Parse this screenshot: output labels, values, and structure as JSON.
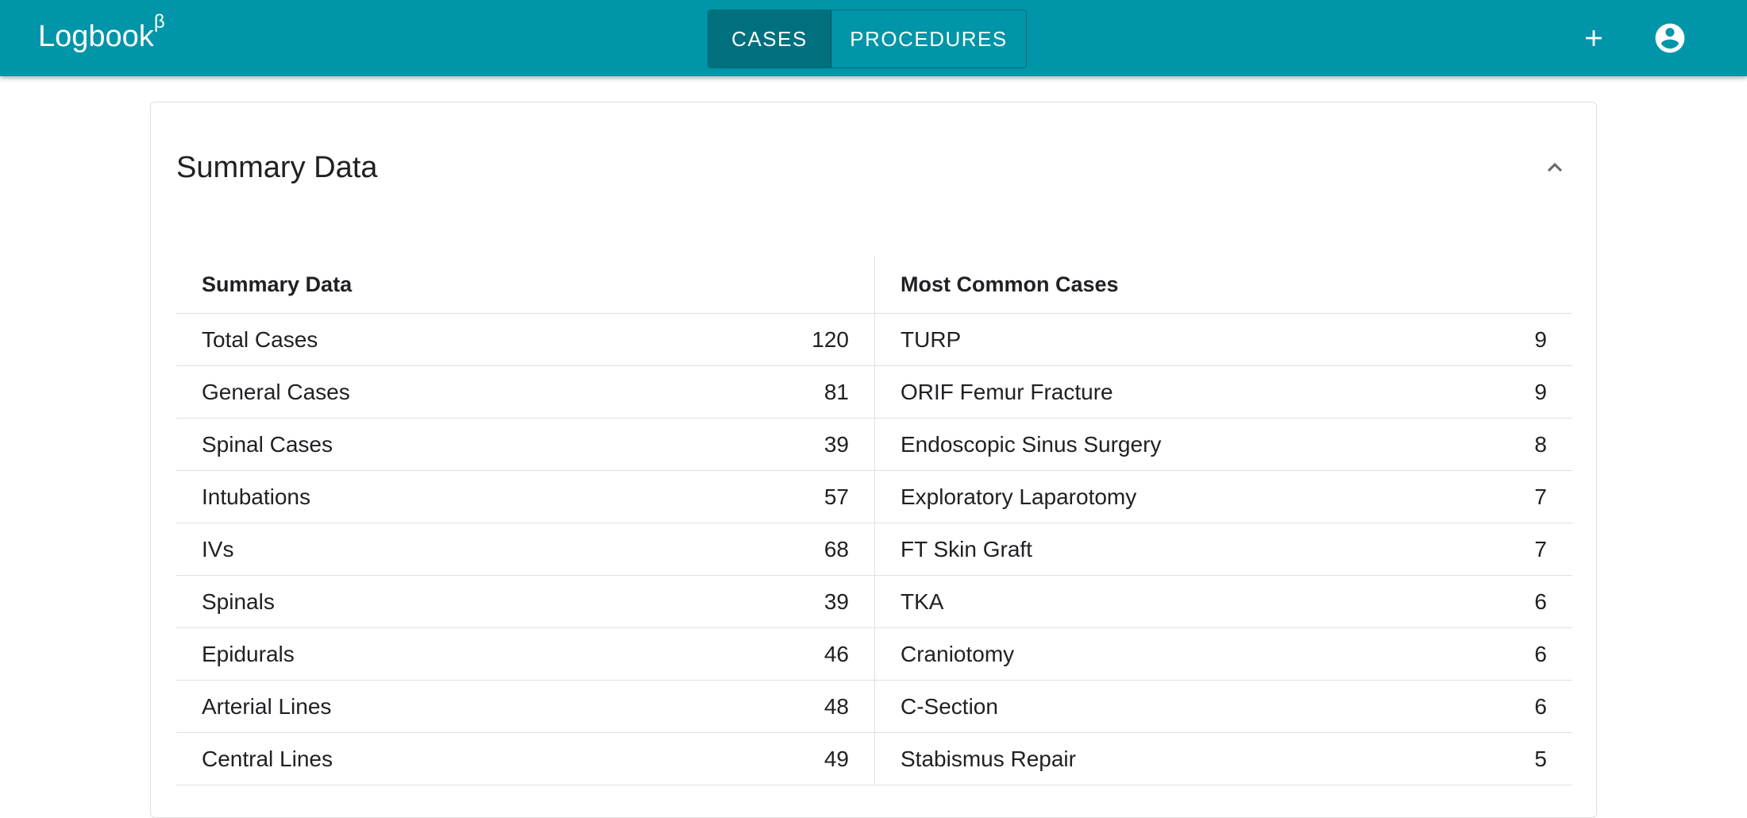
{
  "appbar": {
    "brand": "Logbook",
    "brand_sup": "β",
    "tabs": [
      {
        "label": "CASES",
        "active": true
      },
      {
        "label": "PROCEDURES",
        "active": false
      }
    ],
    "icons": [
      "plus-icon",
      "account-circle-icon"
    ]
  },
  "card": {
    "title": "Summary Data",
    "collapse_icon": "chevron-up-icon"
  },
  "summary_table": {
    "header": "Summary Data",
    "rows": [
      {
        "label": "Total Cases",
        "value": "120"
      },
      {
        "label": "General Cases",
        "value": "81"
      },
      {
        "label": "Spinal Cases",
        "value": "39"
      },
      {
        "label": "Intubations",
        "value": "57"
      },
      {
        "label": "IVs",
        "value": "68"
      },
      {
        "label": "Spinals",
        "value": "39"
      },
      {
        "label": "Epidurals",
        "value": "46"
      },
      {
        "label": "Arterial Lines",
        "value": "48"
      },
      {
        "label": "Central Lines",
        "value": "49"
      }
    ]
  },
  "common_cases_table": {
    "header": "Most Common Cases",
    "rows": [
      {
        "label": "TURP",
        "value": "9"
      },
      {
        "label": "ORIF Femur Fracture",
        "value": "9"
      },
      {
        "label": "Endoscopic Sinus Surgery",
        "value": "8"
      },
      {
        "label": "Exploratory Laparotomy",
        "value": "7"
      },
      {
        "label": "FT Skin Graft",
        "value": "7"
      },
      {
        "label": "TKA",
        "value": "6"
      },
      {
        "label": "Craniotomy",
        "value": "6"
      },
      {
        "label": "C-Section",
        "value": "6"
      },
      {
        "label": "Stabismus Repair",
        "value": "5"
      }
    ]
  },
  "colors": {
    "appbar": "#0095a8",
    "tab_active": "#00707f"
  }
}
